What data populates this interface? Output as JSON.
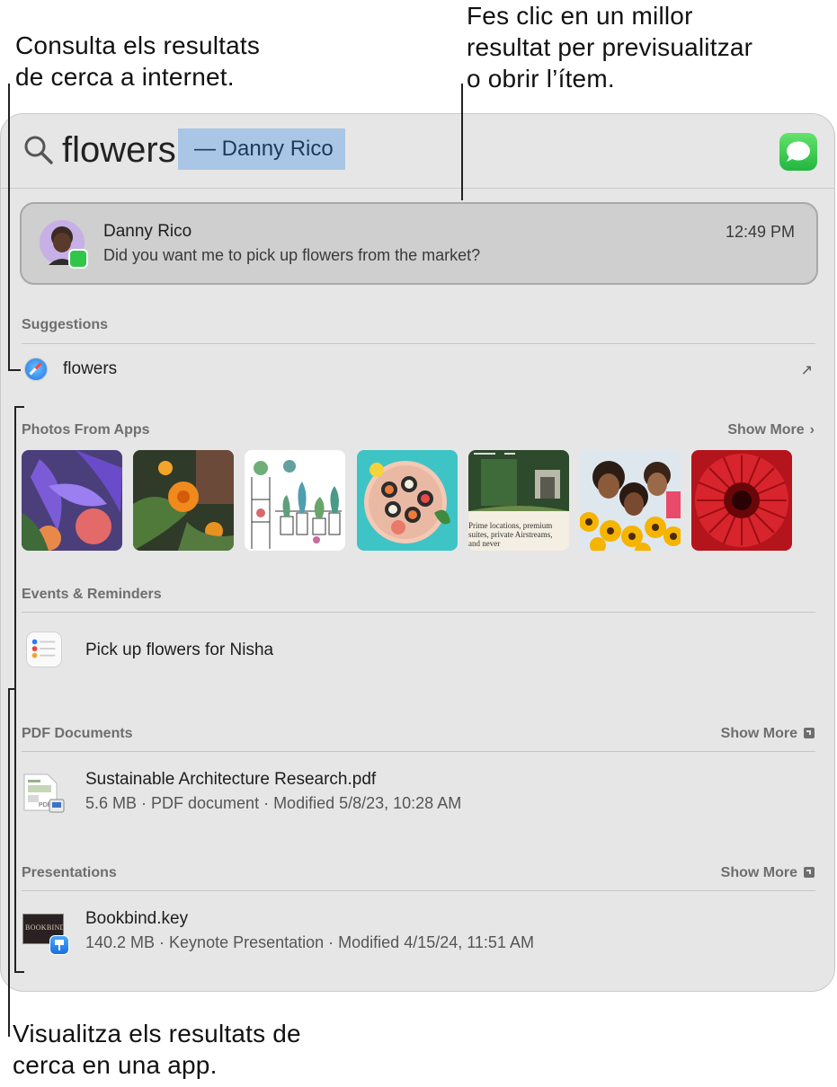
{
  "callouts": {
    "top_right": [
      "Fes clic en un millor",
      "resultat per previsualitzar",
      "o obrir l’ítem."
    ],
    "top_left": [
      "Consulta els resultats",
      "de cerca a internet."
    ],
    "bottom": [
      "Visualitza els resultats de",
      "cerca en una app."
    ]
  },
  "search": {
    "query": "flowers",
    "completion": "— Danny Rico",
    "app_icon": "messages-icon"
  },
  "top_hit": {
    "name": "Danny Rico",
    "message": "Did you want me to pick up flowers from the market?",
    "time": "12:49 PM",
    "avatar_icon": "memoji-avatar",
    "badge_icon": "messages-badge-icon"
  },
  "suggestions": {
    "header": "Suggestions",
    "items": [
      {
        "label": "flowers",
        "icon": "safari-icon",
        "action_icon": "open-arrow-icon"
      }
    ]
  },
  "photos": {
    "header": "Photos From Apps",
    "show_more": "Show More",
    "items": [
      {
        "name": "iris-flowers-photo"
      },
      {
        "name": "orange-marigold-photo"
      },
      {
        "name": "plant-sketch-photo"
      },
      {
        "name": "sushi-plate-photo"
      },
      {
        "name": "garden-magazine-photo",
        "caption": "Prime locations, premium suites, private Airstreams, and never"
      },
      {
        "name": "friends-sunflowers-photo"
      },
      {
        "name": "red-gerbera-photo"
      }
    ]
  },
  "events": {
    "header": "Events & Reminders",
    "items": [
      {
        "title": "Pick up flowers for Nisha",
        "icon": "reminders-icon"
      }
    ]
  },
  "pdf": {
    "header": "PDF Documents",
    "show_more": "Show More",
    "items": [
      {
        "title": "Sustainable Architecture Research.pdf",
        "subtitle": "5.6 MB · PDF document · Modified 5/8/23, 10:28 AM",
        "icon": "pdf-document-icon"
      }
    ]
  },
  "presentations": {
    "header": "Presentations",
    "show_more": "Show More",
    "items": [
      {
        "title": "Bookbind.key",
        "subtitle": "140.2 MB · Keynote Presentation · Modified 4/15/24, 11:51 AM",
        "icon": "keynote-document-icon",
        "thumb_text": "BOOKBIND"
      }
    ]
  },
  "colors": {
    "accent_selection": "#a9c6e6",
    "panel": "#e6e6e6"
  }
}
